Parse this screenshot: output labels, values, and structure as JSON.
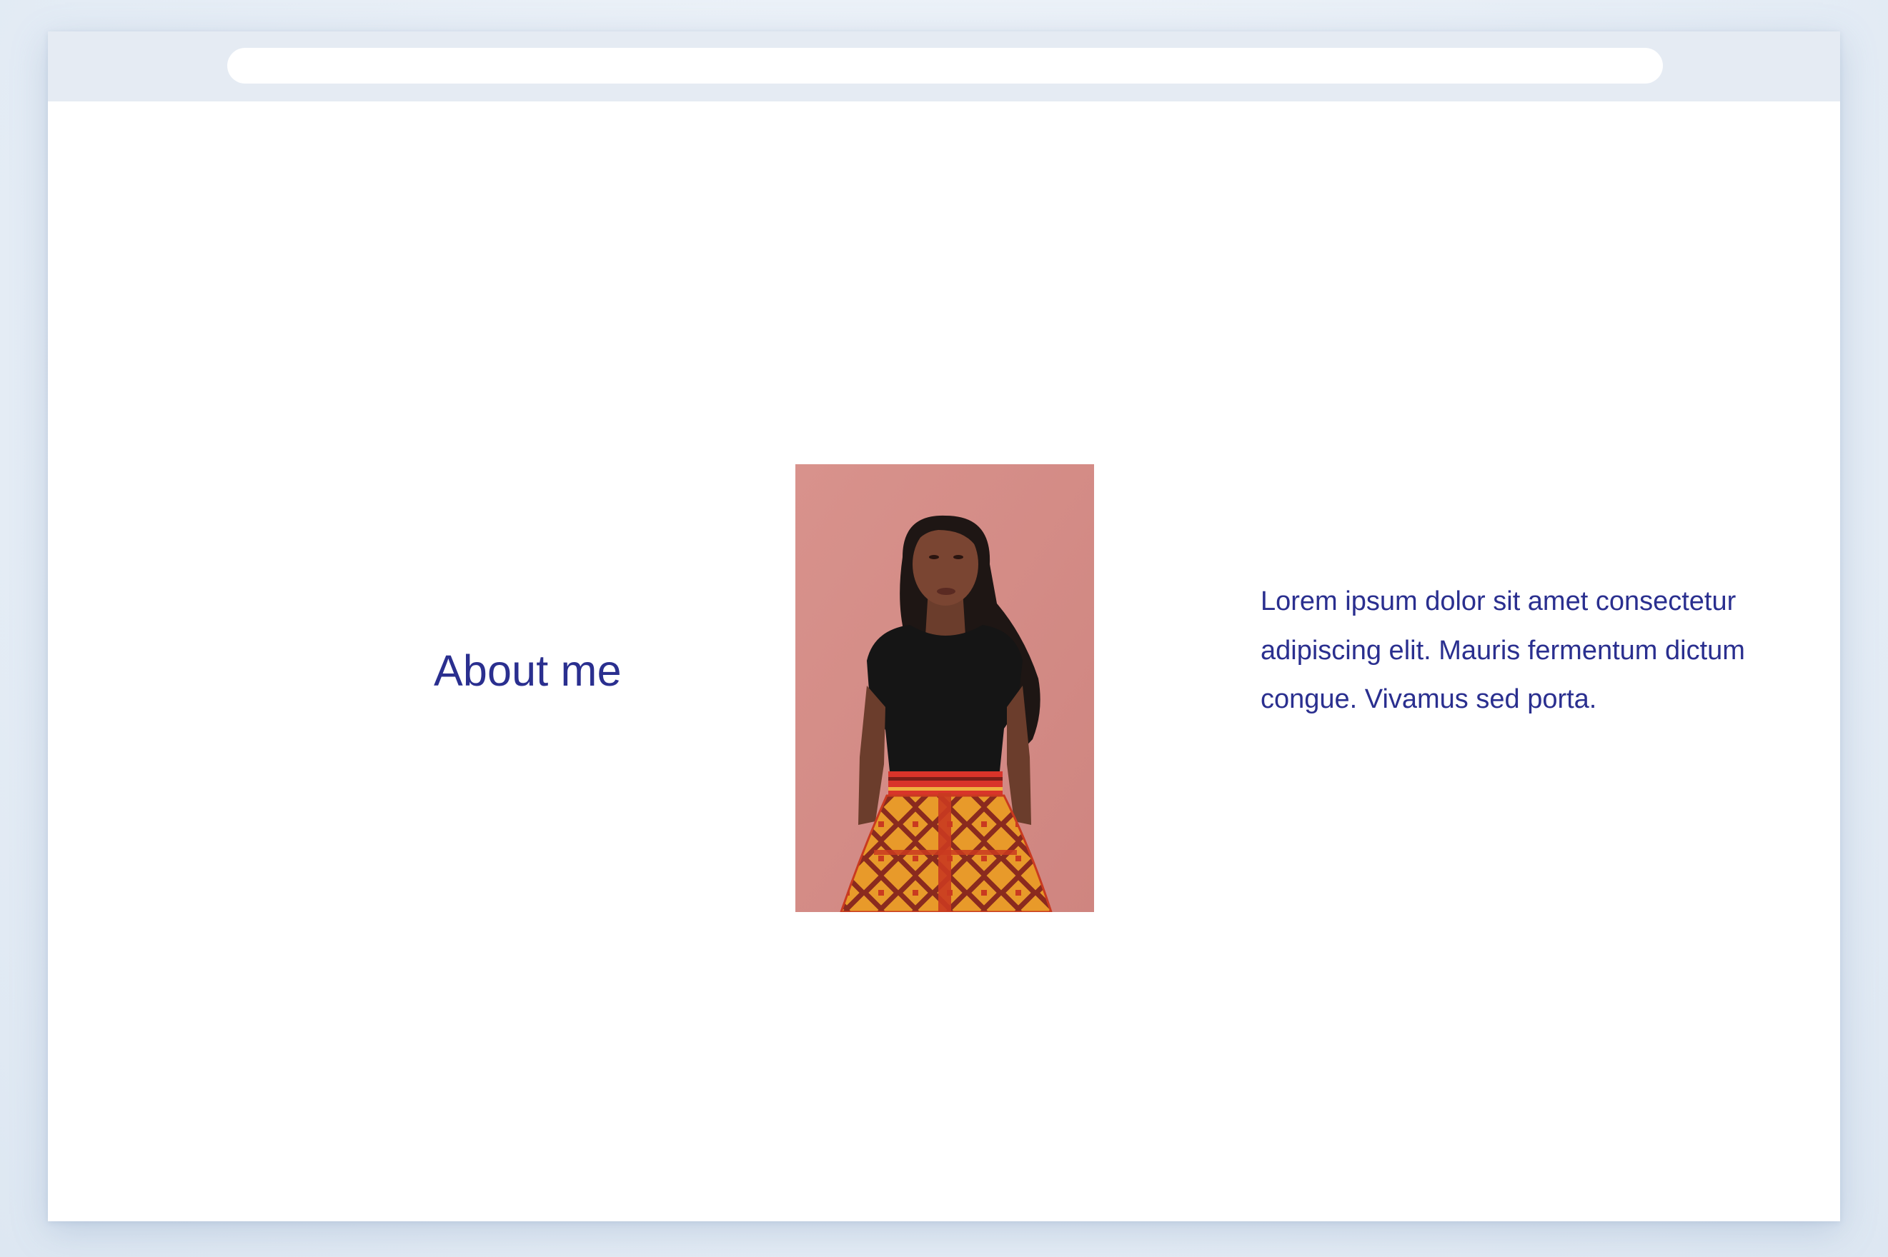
{
  "browser": {
    "address_value": ""
  },
  "about": {
    "title": "About me",
    "bio": "Lorem ipsum dolor sit amet consectetur adipiscing elit. Mauris fermentum dictum congue. Vivamus sed porta."
  },
  "colors": {
    "text": "#2a2f8f",
    "chrome": "#e5ebf3",
    "photo_background": "#d98e89"
  }
}
